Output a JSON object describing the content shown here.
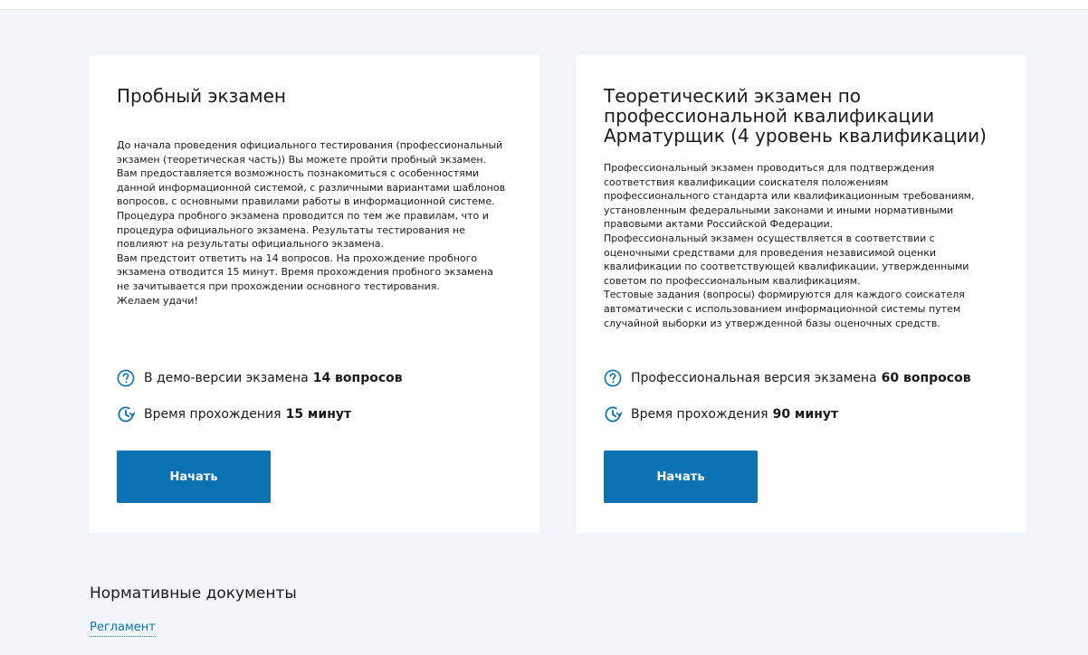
{
  "colors": {
    "accent": "#0b73b1",
    "background": "#f2f5f9",
    "card": "#ffffff"
  },
  "demo_card": {
    "title": "Пробный экзамен",
    "description": "До начала проведения официального тестирования (профессиональный\nэкзамен (теоретическая часть)) Вы можете пройти пробный экзамен.\nВам предоставляется возможность познакомиться с особенностями\nданной информационной системой, с различными вариантами шаблонов\nвопросов, с основными правилами работы в информационной системе.\nПроцедура пробного экзамена проводится по тем же правилам, что и\nпроцедура официального экзамена. Результаты тестирования не\nповлияют на результаты официального экзамена.\nВам предстоит ответить на 14 вопросов. На прохождение пробного\nэкзамена отводится 15 минут. Время прохождения пробного экзамена\nне зачитывается при прохождении основного тестирования.\nЖелаем удачи!",
    "questions_label": "В демо-версии экзамена",
    "questions_value": "14 вопросов",
    "time_label": "Время прохождения",
    "time_value": "15 минут",
    "start_label": "Начать",
    "icons": {
      "questions": "question-circle-icon",
      "time": "clock-icon"
    }
  },
  "pro_card": {
    "title": "Теоретический экзамен по профессиональной квалификации Арматурщик (4 уровень квалификации)",
    "description": "Профессиональный экзамен проводиться для подтверждения\nсоответствия квалификации соискателя положениям\nпрофессионального стандарта или квалификационным требованиям,\nустановленным федеральными законами и иными нормативными\nправовыми актами Российской Федерации.\nПрофессиональный экзамен осуществляется в соответствии с\nоценочными средствами для проведения независимой оценки\nквалификации по соответствующей квалификации, утвержденными\nсоветом по профессиональным квалификациям.\nТестовые задания (вопросы) формируются для каждого соискателя\nавтоматически с использованием информационной системы путем\nслучайной выборки из утвержденной базы оценочных средств.",
    "questions_label": "Профессиональная версия экзамена",
    "questions_value": "60 вопросов",
    "time_label": "Время прохождения",
    "time_value": "90 минут",
    "start_label": "Начать",
    "icons": {
      "questions": "question-circle-icon",
      "time": "clock-icon"
    }
  },
  "documents": {
    "title": "Нормативные документы",
    "links": [
      {
        "label": "Регламент"
      }
    ]
  }
}
